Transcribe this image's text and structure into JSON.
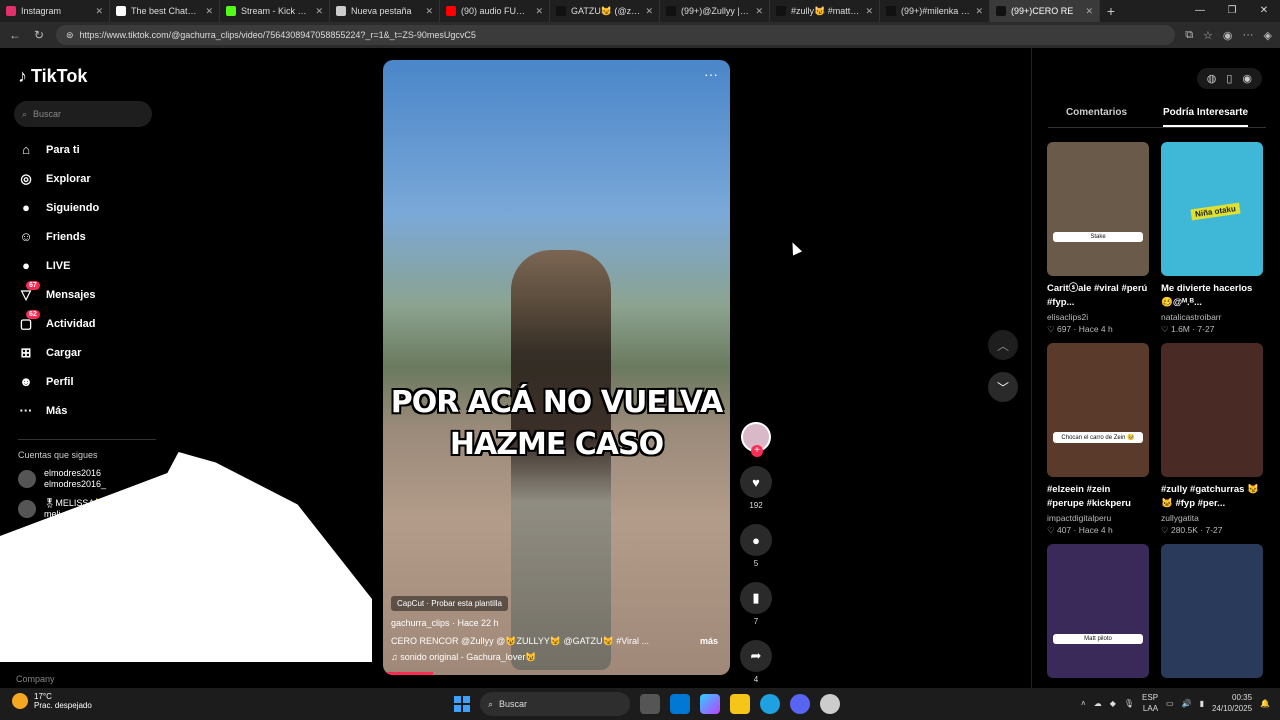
{
  "browser": {
    "tabs": [
      {
        "label": "Instagram",
        "color": "#e1306c",
        "active": false
      },
      {
        "label": "The best ChatBot an",
        "color": "#ffffff",
        "active": false
      },
      {
        "label": "Stream - Kick Dashb",
        "color": "#53fc18",
        "active": false
      },
      {
        "label": "Nueva pestaña",
        "color": "#cccccc",
        "active": false
      },
      {
        "label": "(90) audio FUEGO, I",
        "color": "#ff0000",
        "active": false
      },
      {
        "label": "GATZU😼 (@zullyy",
        "color": "#111111",
        "active": false
      },
      {
        "label": "(99+)@Zullyy | zul",
        "color": "#111111",
        "active": false
      },
      {
        "label": "#zully😼 #mattkee",
        "color": "#111111",
        "active": false
      },
      {
        "label": "(99+)#milenka #pi",
        "color": "#111111",
        "active": false
      },
      {
        "label": "(99+)CERO RE",
        "color": "#111111",
        "active": true
      }
    ],
    "url": "https://www.tiktok.com/@gachurra_clips/video/7564308947058855224?_r=1&_t=ZS-90mesUgcvC5"
  },
  "sidebar": {
    "logo": "TikTok",
    "search_placeholder": "Buscar",
    "items": [
      {
        "label": "Para ti",
        "icon": "⌂",
        "name": "home-icon"
      },
      {
        "label": "Explorar",
        "icon": "◎",
        "name": "compass-icon"
      },
      {
        "label": "Siguiendo",
        "icon": "●",
        "name": "following-avatar-icon"
      },
      {
        "label": "Friends",
        "icon": "☺",
        "name": "friends-icon"
      },
      {
        "label": "LIVE",
        "icon": "●",
        "name": "live-icon"
      },
      {
        "label": "Mensajes",
        "icon": "▽",
        "name": "messages-icon",
        "badge": "67"
      },
      {
        "label": "Actividad",
        "icon": "▢",
        "name": "activity-icon",
        "badge": "62"
      },
      {
        "label": "Cargar",
        "icon": "⊞",
        "name": "upload-icon"
      },
      {
        "label": "Perfil",
        "icon": "☻",
        "name": "profile-icon"
      },
      {
        "label": "Más",
        "icon": "···",
        "name": "more-icon"
      }
    ],
    "following_title": "Cuentas que sigues",
    "following": [
      {
        "name": "elmodres2016",
        "handle": "elmodres2016_"
      },
      {
        "name": "🎖MELISSA😼",
        "handle": "meli.gimrat"
      },
      {
        "name": "osne Su",
        "handle": ""
      }
    ],
    "company": "Company"
  },
  "video": {
    "caption_line1": "POR ACÁ NO VUELVA",
    "caption_line2": "HAZME CASO",
    "capcut": "CapCut · Probar esta plantilla",
    "author": "gachurra_clips · Hace 22 h",
    "description": "CERO RENCOR @Zullyy  @😼ZULLYY😼  @GATZU😼 #Viral ...",
    "more": "más",
    "sound": "♫  sonido original - Gachura_lover😼",
    "likes": "192",
    "comments": "5",
    "saves": "7",
    "shares": "4"
  },
  "panel": {
    "tab_comments": "Comentarios",
    "tab_interest": "Podría Interesarte",
    "cards": [
      {
        "title": "Caritⓢale #viral #perú #fyp...",
        "user": "elisaclips2i",
        "meta": "♡ 697 · Hace 4 h",
        "bg": "#6a5a4a",
        "tag": "Stake"
      },
      {
        "title": "Me divierte hacerlos 🥴@ᴹ.ᴮ...",
        "user": "natalicastroibarr",
        "meta": "♡ 1.6M · 7-27",
        "bg": "#3fb8d8",
        "tag": "Niña otaku"
      },
      {
        "title": "#elzeein #zein #perupe #kickperu",
        "user": "impactdigitalperu",
        "meta": "♡ 407 · Hace 4 h",
        "bg": "#5a3a2a",
        "tag": "Chocan el carro de Zein 🥹"
      },
      {
        "title": "#zully #gatchurras 😼🐱 #fyp #per...",
        "user": "zullygatita",
        "meta": "♡ 280.5K · 7-27",
        "bg": "#4a2a24",
        "tag": ""
      },
      {
        "title": "",
        "user": "",
        "meta": "",
        "bg": "#3a2a5a",
        "tag": "Matt piloto"
      },
      {
        "title": "",
        "user": "",
        "meta": "",
        "bg": "#2a3a5a",
        "tag": ""
      }
    ]
  },
  "taskbar": {
    "temp": "17°C",
    "weather": "Prac. despejado",
    "search": "Buscar",
    "lang1": "ESP",
    "lang2": "LAA",
    "time": "00:35",
    "date": "24/10/2025"
  }
}
